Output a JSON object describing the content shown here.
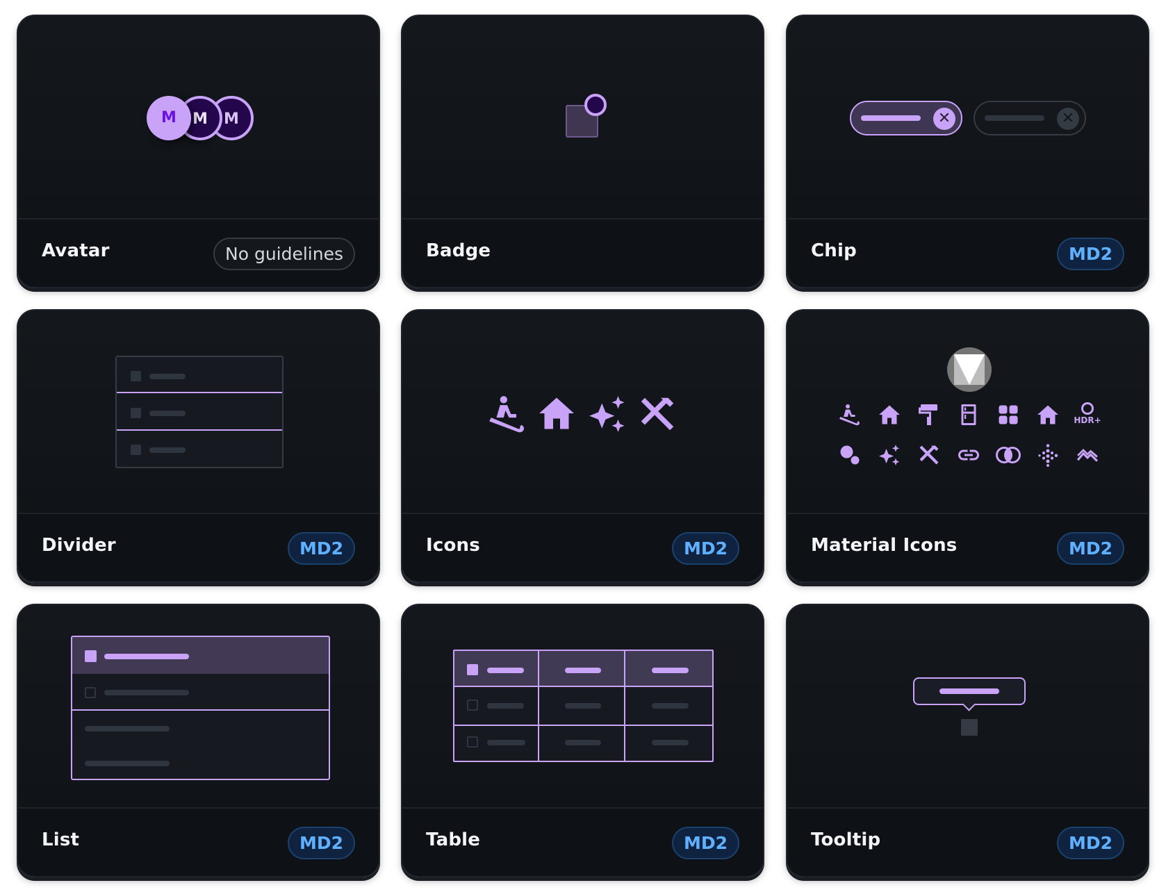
{
  "colors": {
    "accent": "#c9a3f7",
    "card_bg": "#12161b",
    "md2_badge_text": "#5fb0ff",
    "md2_badge_bg": "#0f2340"
  },
  "cards": [
    {
      "title": "Avatar",
      "badge": "No guidelines",
      "preview": {
        "avatars": [
          "M",
          "M",
          "M"
        ]
      }
    },
    {
      "title": "Badge",
      "badge": ""
    },
    {
      "title": "Chip",
      "badge": "MD2"
    },
    {
      "title": "Divider",
      "badge": "MD2"
    },
    {
      "title": "Icons",
      "badge": "MD2",
      "icons": [
        "sledding-icon",
        "home-icon",
        "sparkles-icon",
        "tools-icon"
      ]
    },
    {
      "title": "Material Icons",
      "badge": "MD2",
      "logo": "material-logo",
      "icons": [
        "sledding-icon",
        "home-icon",
        "paint-roller-icon",
        "fridge-icon",
        "grid-icon",
        "home-icon",
        "hdr-plus-icon",
        "gears-icon",
        "sparkles-icon",
        "tools-icon",
        "link-icon",
        "join-icon",
        "dots-icon",
        "trending-icon"
      ],
      "hdr_label": "HDR+"
    },
    {
      "title": "List",
      "badge": "MD2"
    },
    {
      "title": "Table",
      "badge": "MD2"
    },
    {
      "title": "Tooltip",
      "badge": "MD2"
    }
  ]
}
